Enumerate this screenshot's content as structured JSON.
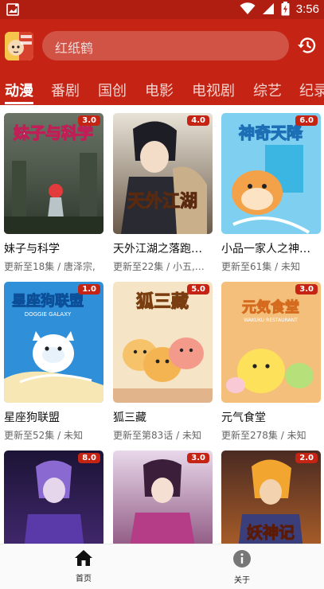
{
  "status": {
    "time": "3:56"
  },
  "search": {
    "placeholder": "红纸鹤"
  },
  "tabs": [
    {
      "label": "动漫"
    },
    {
      "label": "番剧"
    },
    {
      "label": "国创"
    },
    {
      "label": "电影"
    },
    {
      "label": "电视剧"
    },
    {
      "label": "综艺"
    },
    {
      "label": "纪录"
    }
  ],
  "cards": [
    {
      "title": "妹子与科学",
      "subtitle": "更新至18集 / 唐泽宗,",
      "rating": "3.0",
      "poster_text": "妹子与科学"
    },
    {
      "title": "天外江湖之落跑…",
      "subtitle": "更新至22集 / 小五,东…",
      "rating": "4.0",
      "poster_text": "天外江湖"
    },
    {
      "title": "小品一家人之神…",
      "subtitle": "更新至61集 / 未知",
      "rating": "6.0",
      "poster_text": "神奇天降"
    },
    {
      "title": "星座狗联盟",
      "subtitle": "更新至52集 / 未知",
      "rating": "1.0",
      "poster_text": "星座狗联盟",
      "poster_sub": "DOGGIE GALAXY"
    },
    {
      "title": "狐三藏",
      "subtitle": "更新至第83话 / 未知",
      "rating": "5.0",
      "poster_text": "狐三藏"
    },
    {
      "title": "元气食堂",
      "subtitle": "更新至278集 / 未知",
      "rating": "3.0",
      "poster_text": "元気食堂",
      "poster_sub": "WAKUKU RESTAURANT"
    },
    {
      "title": "",
      "subtitle": "",
      "rating": "8.0"
    },
    {
      "title": "",
      "subtitle": "",
      "rating": "3.0"
    },
    {
      "title": "",
      "subtitle": "",
      "rating": "2.0",
      "poster_text": "妖神记"
    }
  ],
  "bottom_nav": [
    {
      "label": "首页",
      "icon": "home-icon"
    },
    {
      "label": "关于",
      "icon": "info-icon"
    }
  ],
  "colors": {
    "primary": "#c52313",
    "statusbar": "#b01e12",
    "badge": "#c52313"
  }
}
